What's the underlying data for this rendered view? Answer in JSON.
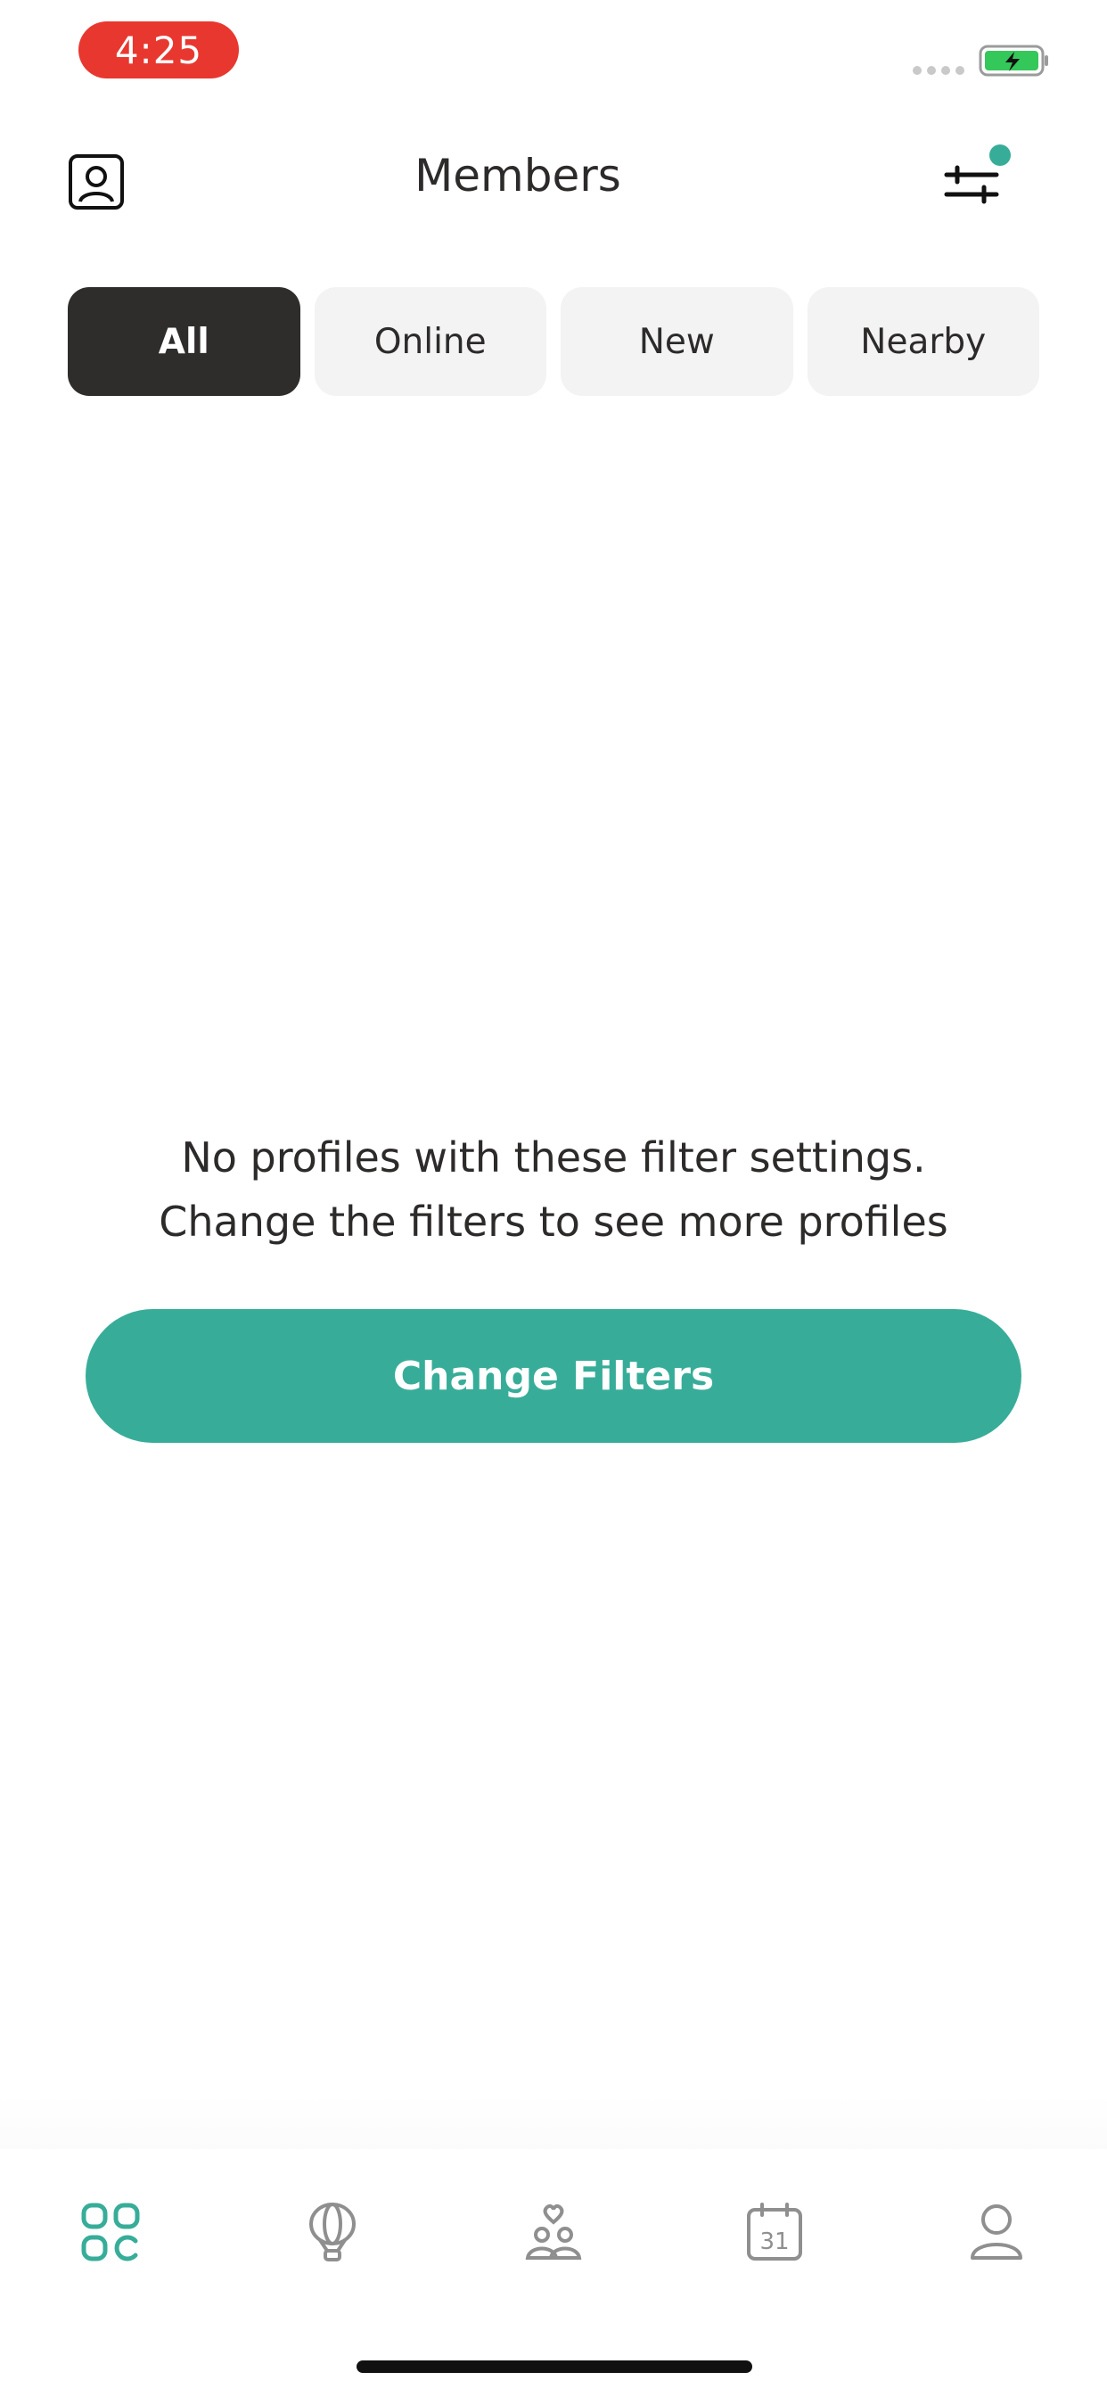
{
  "status_bar": {
    "time": "4:25"
  },
  "header": {
    "title": "Members"
  },
  "tabs": [
    {
      "label": "All",
      "active": true
    },
    {
      "label": "Online",
      "active": false
    },
    {
      "label": "New",
      "active": false
    },
    {
      "label": "Nearby",
      "active": false
    }
  ],
  "empty_state": {
    "line1": "No profiles with these filter settings.",
    "line2": "Change the filters to see more profiles",
    "button_label": "Change Filters"
  },
  "bottom_nav": [
    {
      "icon": "grid-icon",
      "active": true
    },
    {
      "icon": "balloon-icon",
      "active": false
    },
    {
      "icon": "couple-heart-icon",
      "active": false
    },
    {
      "icon": "calendar-icon",
      "active": false,
      "text": "31"
    },
    {
      "icon": "user-icon",
      "active": false
    }
  ],
  "colors": {
    "accent": "#37ad99",
    "dark": "#2f2c2c",
    "tab_bg": "#f3f3f3",
    "time_pill": "#e8372f"
  }
}
